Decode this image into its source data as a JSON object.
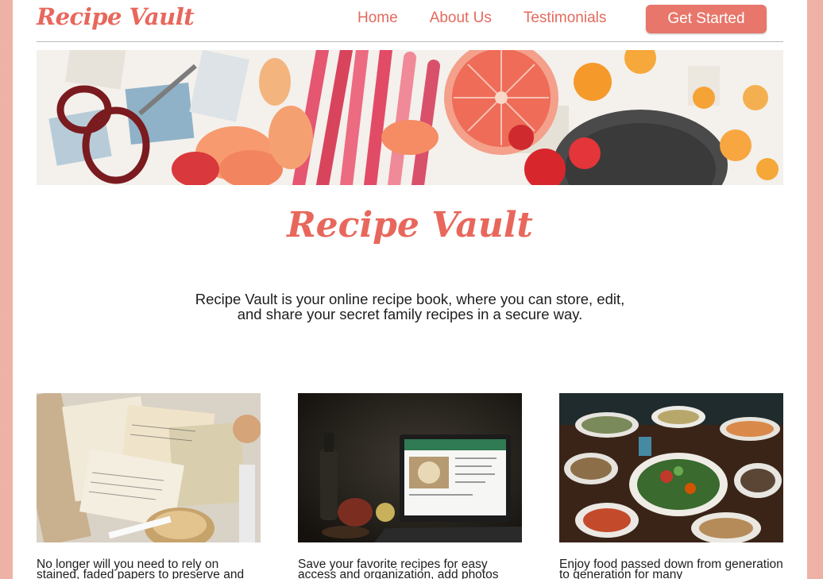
{
  "nav": {
    "brand": "Recipe Vault",
    "links": [
      {
        "label": "Home"
      },
      {
        "label": "About Us"
      },
      {
        "label": "Testimonials"
      }
    ],
    "cta_label": "Get Started"
  },
  "main": {
    "title": "Recipe Vault",
    "tagline_line1": "Recipe Vault is your online recipe book, where you can store, edit,",
    "tagline_line2": "and share your secret family recipes in a secure way."
  },
  "features": [
    {
      "text": "No longer will you need to rely on stained, faded papers to preserve and"
    },
    {
      "text": "Save your favorite recipes for easy access and organization, add photos"
    },
    {
      "text": "Enjoy food passed down from generation to generation for many"
    }
  ],
  "colors": {
    "accent": "#e8675c",
    "button": "#e8766a",
    "side_background": "#eeb1a6",
    "text": "#1e1e1e"
  }
}
